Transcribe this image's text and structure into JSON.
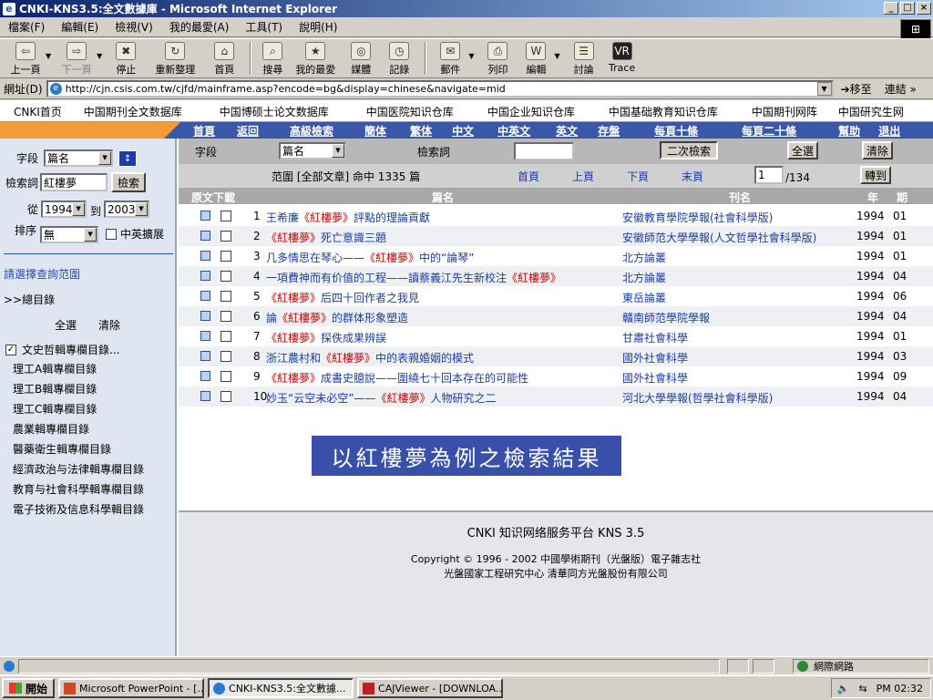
{
  "window": {
    "title": "CNKI-KNS3.5:全文數據庫 - Microsoft Internet Explorer",
    "btn_min": "_",
    "btn_max": "□",
    "btn_close": "×"
  },
  "menu": [
    "檔案(F)",
    "編輯(E)",
    "檢視(V)",
    "我的最愛(A)",
    "工具(T)",
    "說明(H)"
  ],
  "toolbar": {
    "back": "上一頁",
    "forward": "下一頁",
    "stop": "停止",
    "refresh": "重新整理",
    "home": "首頁",
    "search": "搜尋",
    "favorites": "我的最愛",
    "media": "媒體",
    "history": "記錄",
    "mail": "郵件",
    "print": "列印",
    "edit": "編輯",
    "discuss": "討論",
    "trace": "Trace"
  },
  "address": {
    "label": "網址(D)",
    "url": "http://cjn.csis.com.tw/cjfd/mainframe.asp?encode=bg&display=chinese&navigate=mid",
    "go": "移至",
    "links": "連結"
  },
  "topnav": [
    "CNKI首页",
    "中国期刊全文数据库",
    "中国博硕士论文数据库",
    "中国医院知识仓库",
    "中国企业知识仓库",
    "中国基础教育知识仓库",
    "中国期刊网阵",
    "中国研究生网"
  ],
  "bluenav": [
    "首頁",
    "返回",
    "高級檢索",
    "簡体",
    "繁体",
    "中文",
    "中英文",
    "英文",
    "存盤",
    "每頁十條",
    "每頁二十條",
    "幫助",
    "退出"
  ],
  "left": {
    "field_label": "字段",
    "field_value": "篇名",
    "term_label": "檢索詞",
    "term_value": "紅樓夢",
    "search_btn": "檢索",
    "from_label": "從",
    "from_value": "1994",
    "to_label": "到",
    "to_value": "2003",
    "sort_label": "排序",
    "sort_value": "無",
    "cn_en_label": "中英擴展",
    "choose_range": "請選擇查詢范圍",
    "total_dir": ">>總目錄",
    "select_all": "全選",
    "clear": "清除",
    "categories": [
      "文史哲輯專欄目錄...",
      "理工A輯專欄目錄",
      "理工B輯專欄目錄",
      "理工C輯專欄目錄",
      "農業輯專欄目錄",
      "醫藥衛生輯專欄目錄",
      "經濟政治与法律輯專欄目錄",
      "教育与社會科學輯專欄目錄",
      "電子技術及信息科學輯目錄"
    ]
  },
  "main": {
    "field_label": "字段",
    "field_value": "篇名",
    "term_label": "檢索詞",
    "secondary_search": "二次檢索",
    "select_all": "全選",
    "clear": "清除",
    "range_text": "范圍 [全部文章] 命中 1335 篇",
    "first": "首頁",
    "prev": "上頁",
    "next": "下頁",
    "last": "末頁",
    "page_value": "1",
    "page_total": "/134",
    "goto": "轉到",
    "headers": {
      "download": "原文下載",
      "title": "篇名",
      "journal": "刊名",
      "year": "年",
      "issue": "期"
    },
    "rows": [
      {
        "num": "1",
        "pre": "王希廉",
        "kw": "《紅樓夢》",
        "post": "評點的理論貢獻",
        "journal": "安徽教育學院學報(社會科學版)",
        "year": "1994",
        "issue": "01"
      },
      {
        "num": "2",
        "pre": "",
        "kw": "《紅樓夢》",
        "post": "死亡意識三題",
        "journal": "安徽師范大學學報(人文哲學社會科學版)",
        "year": "1994",
        "issue": "01"
      },
      {
        "num": "3",
        "pre": "几多情思在琴心——",
        "kw": "《紅樓夢》",
        "post": "中的“論琴”",
        "journal": "北方論叢",
        "year": "1994",
        "issue": "01"
      },
      {
        "num": "4",
        "pre": "一項費神而有价值的工程——讀蔡義江先生新校注",
        "kw": "《紅樓夢》",
        "post": "",
        "journal": "北方論叢",
        "year": "1994",
        "issue": "04"
      },
      {
        "num": "5",
        "pre": "",
        "kw": "《紅樓夢》",
        "post": "后四十回作者之我見",
        "journal": "東岳論叢",
        "year": "1994",
        "issue": "06"
      },
      {
        "num": "6",
        "pre": "論",
        "kw": "《紅樓夢》",
        "post": "的群体形象塑造",
        "journal": "贛南師范學院學報",
        "year": "1994",
        "issue": "04"
      },
      {
        "num": "7",
        "pre": "",
        "kw": "《紅樓夢》",
        "post": "探佚成果辨誤",
        "journal": "甘肅社會科學",
        "year": "1994",
        "issue": "01"
      },
      {
        "num": "8",
        "pre": "浙江農村和",
        "kw": "《紅樓夢》",
        "post": "中的表親婚姻的模式",
        "journal": "國外社會科學",
        "year": "1994",
        "issue": "03"
      },
      {
        "num": "9",
        "pre": "",
        "kw": "《紅樓夢》",
        "post": "成書史臆說——圍繞七十回本存在的可能性",
        "journal": "國外社會科學",
        "year": "1994",
        "issue": "09"
      },
      {
        "num": "10",
        "pre": "妙玉“云空未必空”——",
        "kw": "《紅樓夢》",
        "post": "人物研究之二",
        "journal": "河北大學學報(哲學社會科學版)",
        "year": "1994",
        "issue": "04"
      }
    ],
    "banner": "以紅樓夢為例之檢索結果"
  },
  "footer": {
    "line1": "CNKI 知识网络服务平台  KNS 3.5",
    "line2": "Copyright © 1996 - 2002  中國學術期刊（光盤版）電子雜志社",
    "line3": "光盤國家工程研究中心  清華同方光盤股份有限公司"
  },
  "status": {
    "zone": "網際網路"
  },
  "taskbar": {
    "start": "開始",
    "tasks": [
      "Microsoft PowerPoint - [...",
      "CNKI-KNS3.5:全文數據...",
      "CAJViewer - [DOWNLOA..."
    ],
    "clock": "PM 02:32"
  }
}
